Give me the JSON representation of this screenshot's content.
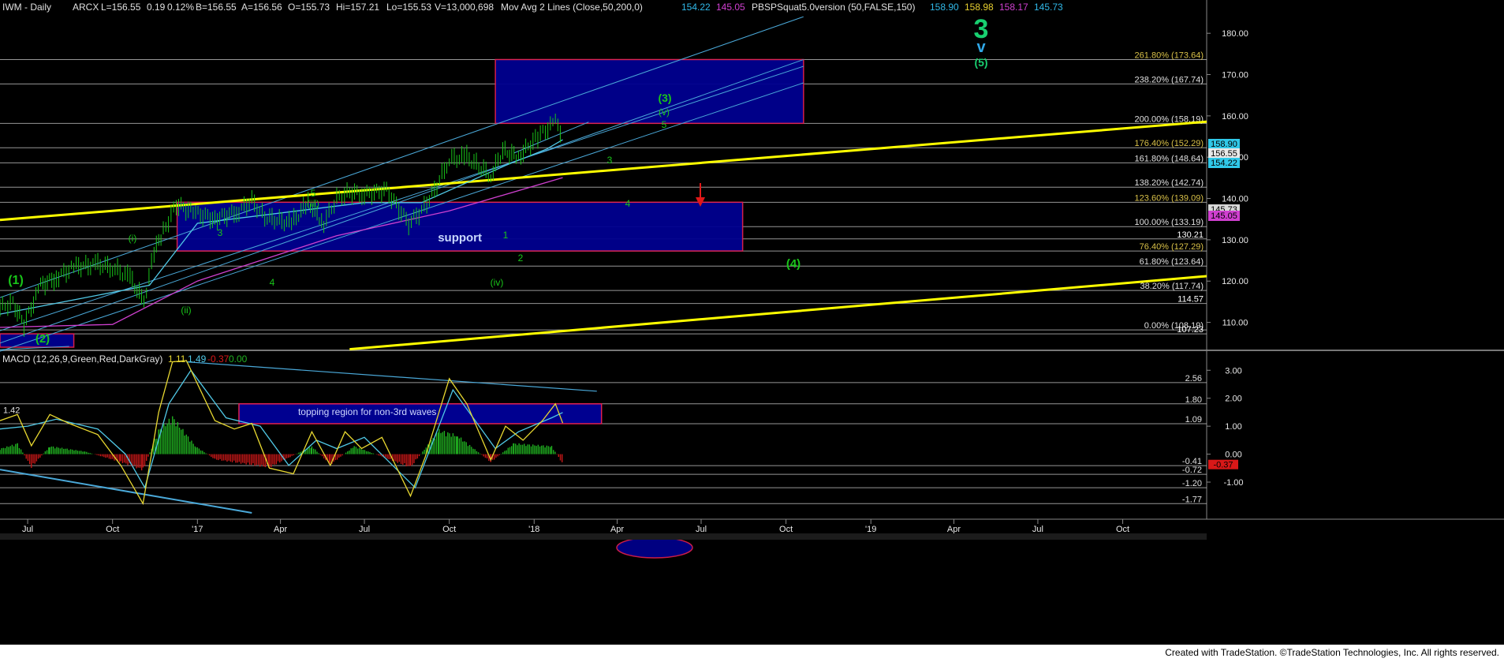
{
  "footer": {
    "credit": "Created with TradeStation. ©TradeStation Technologies, Inc. All rights reserved."
  },
  "chart_data": [
    {
      "type": "line",
      "panel": "price",
      "header": {
        "symbol": "IWM - Daily",
        "exchange": "ARCX",
        "last": "L=156.55",
        "change": "0.19",
        "change_pct": "0.12%",
        "bid": "B=156.55",
        "ask": "A=156.56",
        "open": "O=155.73",
        "high": "Hi=157.21",
        "low": "Lo=155.53",
        "volume": "V=13,000,698",
        "study1": "Mov Avg 2 Lines (Close,50,200,0)",
        "study1_values": [
          "154.22",
          "145.05"
        ],
        "study2": "PBSPSquat5.0version (50,FALSE,150)",
        "study2_values": [
          "158.90",
          "158.98",
          "158.17",
          "145.73"
        ]
      },
      "colors": {
        "price": "#19c519",
        "ma50": "#50c8e6",
        "ma200": "#d040d0",
        "channel": "#4aa8d8",
        "yellow": "#ffff00",
        "box": "#000090",
        "box_border": "#e02050",
        "hline": "#c8c8c8",
        "label": "#19c519"
      },
      "x_axis": {
        "labels": [
          "Jul",
          "Oct",
          "'17",
          "Apr",
          "Jul",
          "Oct",
          "'18",
          "Apr",
          "Jul",
          "Oct",
          "'19",
          "Apr",
          "Jul",
          "Oct"
        ],
        "dates": [
          "2016-07-01",
          "2016-10-01",
          "2017-01-01",
          "2017-04-01",
          "2017-07-01",
          "2017-10-01",
          "2018-01-01",
          "2018-04-01",
          "2018-07-01",
          "2018-10-01",
          "2019-01-01",
          "2019-04-01",
          "2019-07-01",
          "2019-10-01"
        ]
      },
      "y_axis": {
        "ticks": [
          "180.00",
          "170.00",
          "160.00",
          "150.00",
          "140.00",
          "130.00",
          "120.00",
          "110.00"
        ],
        "range": [
          104,
          185
        ]
      },
      "last_values": [
        "158.90",
        "156.55",
        "154.22",
        "145.73",
        "145.05"
      ],
      "fib_levels": [
        {
          "label": "261.80% (173.64)",
          "value": 173.64
        },
        {
          "label": "238.20% (167.74)",
          "value": 167.74
        },
        {
          "label": "200.00% (158.19)",
          "value": 158.19
        },
        {
          "label": "176.40% (152.29)",
          "value": 152.29
        },
        {
          "label": "161.80% (148.64)",
          "value": 148.64
        },
        {
          "label": "138.20% (142.74)",
          "value": 142.74
        },
        {
          "label": "123.60% (139.09)",
          "value": 139.09
        },
        {
          "label": "100.00% (133.19)",
          "value": 133.19
        },
        {
          "label": "130.21",
          "value": 130.21
        },
        {
          "label": "76.40% (127.29)",
          "value": 127.29
        },
        {
          "label": "61.80% (123.64)",
          "value": 123.64
        },
        {
          "label": "38.20% (117.74)",
          "value": 117.74
        },
        {
          "label": "114.57",
          "value": 114.57
        },
        {
          "label": "0.00% (108.19)",
          "value": 108.19
        },
        {
          "label": "107.23",
          "value": 107.23
        }
      ],
      "zones": [
        {
          "label": "",
          "x": [
            "2017-11-20",
            "2018-10-20"
          ],
          "y": [
            158.19,
            173.64
          ]
        },
        {
          "label": "support",
          "x": [
            "2016-12-10",
            "2018-08-15"
          ],
          "y": [
            127.29,
            139.09
          ]
        },
        {
          "label": "",
          "x": [
            "2016-06-01",
            "2016-08-20"
          ],
          "y": [
            104.0,
            107.23
          ]
        }
      ],
      "wave_labels": [
        "(1)",
        "(2)",
        "(i)",
        "(ii)",
        "3",
        "4",
        "(iii)",
        "5",
        "(iv)",
        "1",
        "2",
        "3",
        "4",
        "5",
        "(v)",
        "(3)",
        "(4)",
        "(5)",
        "v",
        "3"
      ],
      "price_series": [
        [
          "2016-06-01",
          113.5
        ],
        [
          "2016-06-15",
          114.8
        ],
        [
          "2016-06-27",
          109.5
        ],
        [
          "2016-07-15",
          119.0
        ],
        [
          "2016-08-01",
          120.8
        ],
        [
          "2016-08-20",
          123.5
        ],
        [
          "2016-09-15",
          124.0
        ],
        [
          "2016-10-01",
          123.3
        ],
        [
          "2016-10-20",
          120.8
        ],
        [
          "2016-11-04",
          115.0
        ],
        [
          "2016-11-15",
          127.0
        ],
        [
          "2016-11-25",
          132.0
        ],
        [
          "2016-12-09",
          138.5
        ],
        [
          "2016-12-30",
          136.5
        ],
        [
          "2017-01-20",
          135.0
        ],
        [
          "2017-02-15",
          137.0
        ],
        [
          "2017-03-01",
          139.5
        ],
        [
          "2017-03-15",
          135.5
        ],
        [
          "2017-04-13",
          134.0
        ],
        [
          "2017-05-01",
          139.0
        ],
        [
          "2017-05-18",
          134.0
        ],
        [
          "2017-06-01",
          140.0
        ],
        [
          "2017-06-15",
          141.5
        ],
        [
          "2017-07-01",
          141.0
        ],
        [
          "2017-07-25",
          142.0
        ],
        [
          "2017-08-18",
          134.0
        ],
        [
          "2017-09-01",
          137.0
        ],
        [
          "2017-09-15",
          142.0
        ],
        [
          "2017-10-01",
          149.5
        ],
        [
          "2017-10-20",
          150.0
        ],
        [
          "2017-11-15",
          145.5
        ],
        [
          "2017-11-28",
          151.5
        ],
        [
          "2017-12-15",
          150.0
        ],
        [
          "2018-01-05",
          155.0
        ],
        [
          "2018-01-24",
          158.5
        ],
        [
          "2018-02-01",
          155.5
        ]
      ],
      "ma50_series": [
        [
          "2016-06-01",
          112.0
        ],
        [
          "2016-11-10",
          119.0
        ],
        [
          "2017-01-01",
          134.0
        ],
        [
          "2017-07-01",
          139.0
        ],
        [
          "2017-09-01",
          139.0
        ],
        [
          "2017-12-01",
          148.0
        ],
        [
          "2018-01-15",
          152.0
        ],
        [
          "2018-02-01",
          154.22
        ]
      ],
      "ma200_series": [
        [
          "2016-06-01",
          108.8
        ],
        [
          "2016-10-01",
          109.5
        ],
        [
          "2017-01-01",
          120.0
        ],
        [
          "2017-06-01",
          131.0
        ],
        [
          "2017-10-01",
          137.0
        ],
        [
          "2018-02-01",
          145.05
        ]
      ]
    },
    {
      "type": "bar",
      "panel": "macd",
      "header": {
        "name": "MACD (12,26,9,Green,Red,DarkGray)",
        "macd": "1.11",
        "signal": "1.49",
        "diff": "-0.37",
        "zero": "0.00"
      },
      "y_axis": {
        "ticks": [
          "3.00",
          "2.00",
          "1.00",
          "0.00",
          "-1.00"
        ],
        "range": [
          -2.1,
          3.6
        ]
      },
      "levels": [
        {
          "label": "2.56",
          "value": 2.56
        },
        {
          "label": "1.80",
          "value": 1.8
        },
        {
          "label": "1.09",
          "value": 1.09
        },
        {
          "label": "-0.41",
          "value": -0.41
        },
        {
          "label": "-0.72",
          "value": -0.72
        },
        {
          "label": "-1.20",
          "value": -1.2
        },
        {
          "label": "-1.77",
          "value": -1.77
        }
      ],
      "left_label": "1.42",
      "last_value": "-0.37",
      "zone": {
        "label": "topping region for non-3rd waves",
        "x": [
          "2017-02-15",
          "2018-03-15"
        ],
        "y": [
          1.09,
          1.8
        ]
      },
      "macd_series": [
        [
          "2016-06-01",
          1.2
        ],
        [
          "2016-06-20",
          1.42
        ],
        [
          "2016-07-05",
          0.3
        ],
        [
          "2016-07-25",
          1.42
        ],
        [
          "2016-08-15",
          1.1
        ],
        [
          "2016-09-15",
          0.7
        ],
        [
          "2016-10-10",
          -0.4
        ],
        [
          "2016-11-03",
          -1.77
        ],
        [
          "2016-11-20",
          1.5
        ],
        [
          "2016-12-05",
          3.3
        ],
        [
          "2016-12-20",
          3.35
        ],
        [
          "2017-01-20",
          1.2
        ],
        [
          "2017-02-10",
          0.9
        ],
        [
          "2017-03-01",
          1.1
        ],
        [
          "2017-03-20",
          -0.5
        ],
        [
          "2017-04-15",
          -0.7
        ],
        [
          "2017-05-05",
          0.8
        ],
        [
          "2017-05-25",
          -0.4
        ],
        [
          "2017-06-10",
          0.8
        ],
        [
          "2017-06-28",
          0.2
        ],
        [
          "2017-07-20",
          0.6
        ],
        [
          "2017-08-20",
          -1.5
        ],
        [
          "2017-09-05",
          -0.1
        ],
        [
          "2017-10-01",
          2.7
        ],
        [
          "2017-10-20",
          1.8
        ],
        [
          "2017-11-15",
          -0.2
        ],
        [
          "2017-12-01",
          1.0
        ],
        [
          "2017-12-20",
          0.5
        ],
        [
          "2018-01-10",
          1.2
        ],
        [
          "2018-01-24",
          1.8
        ],
        [
          "2018-02-01",
          1.11
        ]
      ],
      "signal_series": [
        [
          "2016-06-01",
          0.9
        ],
        [
          "2016-07-01",
          1.0
        ],
        [
          "2016-08-01",
          1.25
        ],
        [
          "2016-09-15",
          0.9
        ],
        [
          "2016-10-15",
          0.0
        ],
        [
          "2016-11-05",
          -1.2
        ],
        [
          "2016-12-01",
          1.8
        ],
        [
          "2016-12-25",
          3.0
        ],
        [
          "2017-02-01",
          1.3
        ],
        [
          "2017-03-10",
          1.0
        ],
        [
          "2017-04-10",
          -0.4
        ],
        [
          "2017-05-10",
          0.5
        ],
        [
          "2017-06-01",
          0.2
        ],
        [
          "2017-07-01",
          0.6
        ],
        [
          "2017-08-25",
          -1.2
        ],
        [
          "2017-10-05",
          2.3
        ],
        [
          "2017-11-20",
          0.2
        ],
        [
          "2017-12-15",
          0.8
        ],
        [
          "2018-01-20",
          1.3
        ],
        [
          "2018-02-01",
          1.49
        ]
      ],
      "histogram_series": [
        [
          "2016-06-01",
          0.2
        ],
        [
          "2016-06-20",
          0.4
        ],
        [
          "2016-07-05",
          -0.5
        ],
        [
          "2016-07-25",
          0.3
        ],
        [
          "2016-09-01",
          0.1
        ],
        [
          "2016-10-10",
          -0.3
        ],
        [
          "2016-11-03",
          -0.6
        ],
        [
          "2016-11-20",
          0.9
        ],
        [
          "2016-12-05",
          1.4
        ],
        [
          "2016-12-30",
          0.3
        ],
        [
          "2017-01-20",
          -0.2
        ],
        [
          "2017-03-20",
          -0.5
        ],
        [
          "2017-05-05",
          0.3
        ],
        [
          "2017-05-25",
          -0.4
        ],
        [
          "2017-06-20",
          0.3
        ],
        [
          "2017-08-20",
          -0.5
        ],
        [
          "2017-09-20",
          0.9
        ],
        [
          "2017-10-10",
          0.7
        ],
        [
          "2017-11-15",
          -0.3
        ],
        [
          "2017-12-10",
          0.4
        ],
        [
          "2018-01-20",
          0.3
        ],
        [
          "2018-02-01",
          -0.37
        ]
      ]
    }
  ]
}
